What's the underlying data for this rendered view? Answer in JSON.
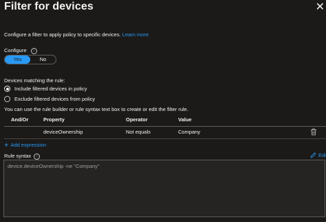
{
  "panel": {
    "title": "Filter for devices",
    "intro_text": "Configure a filter to apply policy to specific devices.",
    "learn_more": "Learn more"
  },
  "configure": {
    "label": "Configure",
    "options": [
      "Yes",
      "No"
    ],
    "selected": "Yes"
  },
  "devices_matching": {
    "label": "Devices matching the rule:",
    "options": [
      "Include filtered devices in policy",
      "Exclude filtered devices from policy"
    ],
    "selected": "Include filtered devices in policy"
  },
  "rule_builder_hint": "You can use the rule builder or rule syntax text box to create or edit the filter rule.",
  "rules_table": {
    "columns": [
      "And/Or",
      "Property",
      "Operator",
      "Value"
    ],
    "rows": [
      {
        "and_or": "",
        "property": "deviceOwnership",
        "operator": "Not equals",
        "value": "Company"
      }
    ]
  },
  "add_expression": "Add expression",
  "rule_syntax": {
    "label": "Rule syntax",
    "edit_label": "Edit",
    "value": "device.deviceOwnership -ne \"Company\""
  },
  "colors": {
    "background": "#1b1a19",
    "accent": "#2899f5",
    "text": "#f3f2f1",
    "muted": "#a19f9d"
  },
  "icons": [
    "close-icon",
    "info-icon",
    "trash-icon",
    "plus-icon",
    "pencil-icon"
  ]
}
